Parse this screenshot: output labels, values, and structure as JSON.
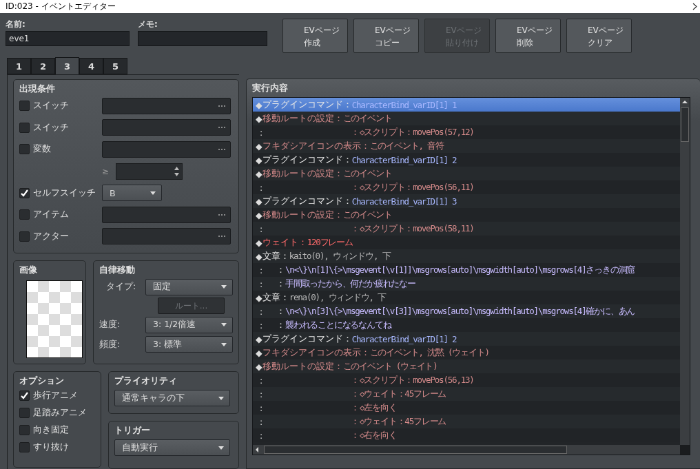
{
  "window": {
    "title": "ID:023 - イベントエディター"
  },
  "name_field": {
    "label": "名前:",
    "value": "eve1"
  },
  "memo_field": {
    "label": "メモ:"
  },
  "page_buttons": [
    {
      "lines": [
        "EVページ",
        "作成"
      ],
      "disabled": false
    },
    {
      "lines": [
        "EVページ",
        "コピー"
      ],
      "disabled": false
    },
    {
      "lines": [
        "EVページ",
        "貼り付け"
      ],
      "disabled": true
    },
    {
      "lines": [
        "EVページ",
        "削除"
      ],
      "disabled": false
    },
    {
      "lines": [
        "EVページ",
        "クリア"
      ],
      "disabled": false
    }
  ],
  "tabs": [
    {
      "label": "1",
      "selected": false
    },
    {
      "label": "2",
      "selected": false
    },
    {
      "label": "3",
      "selected": true
    },
    {
      "label": "4",
      "selected": false
    },
    {
      "label": "5",
      "selected": false
    }
  ],
  "conditions": {
    "title": "出現条件",
    "rows": [
      {
        "kind": "picker",
        "label": "スイッチ",
        "checked": false
      },
      {
        "kind": "picker",
        "label": "スイッチ",
        "checked": false
      },
      {
        "kind": "picker",
        "label": "変数",
        "checked": false
      },
      {
        "kind": "compare",
        "symbol": "≥"
      },
      {
        "kind": "dropdown",
        "label": "セルフスイッチ",
        "checked": true,
        "value": "B"
      },
      {
        "kind": "picker",
        "label": "アイテム",
        "checked": false
      },
      {
        "kind": "picker",
        "label": "アクター",
        "checked": false
      }
    ]
  },
  "image": {
    "title": "画像"
  },
  "movement": {
    "title": "自律移動",
    "type": {
      "label": "タイプ:",
      "value": "固定"
    },
    "route_button": {
      "label": "ルート...",
      "disabled": true
    },
    "speed": {
      "label": "速度:",
      "value": "3: 1/2倍速"
    },
    "frequency": {
      "label": "頻度:",
      "value": "3: 標準"
    }
  },
  "options": {
    "title": "オプション",
    "items": [
      {
        "label": "歩行アニメ",
        "checked": true
      },
      {
        "label": "足踏みアニメ",
        "checked": false
      },
      {
        "label": "向き固定",
        "checked": false
      },
      {
        "label": "すり抜け",
        "checked": false
      }
    ]
  },
  "priority": {
    "title": "プライオリティ",
    "value": "通常キャラの下"
  },
  "trigger": {
    "title": "トリガー",
    "value": "自動実行"
  },
  "commands": {
    "title": "実行内容",
    "rows": [
      {
        "kind": "plugin",
        "marker": "◆",
        "label": "プラグインコマンド：",
        "value": "CharacterBind_varID[1] 1",
        "selected": true
      },
      {
        "kind": "route",
        "marker": "◆",
        "label": "移動ルートの設定：",
        "value": "このイベント",
        "selected": false
      },
      {
        "kind": "route_step",
        "marker": ":",
        "label": "：",
        "value": "◇スクリプト：movePos(57,12)",
        "selected": false
      },
      {
        "kind": "balloon",
        "marker": "◆",
        "label": "フキダシアイコンの表示：",
        "value": "このイベント, 音符",
        "selected": false
      },
      {
        "kind": "plugin",
        "marker": "◆",
        "label": "プラグインコマンド：",
        "value": "CharacterBind_varID[1] 2",
        "selected": false
      },
      {
        "kind": "route",
        "marker": "◆",
        "label": "移動ルートの設定：",
        "value": "このイベント",
        "selected": false
      },
      {
        "kind": "route_step",
        "marker": ":",
        "label": "：",
        "value": "◇スクリプト：movePos(56,11)",
        "selected": false
      },
      {
        "kind": "plugin",
        "marker": "◆",
        "label": "プラグインコマンド：",
        "value": "CharacterBind_varID[1] 3",
        "selected": false
      },
      {
        "kind": "route",
        "marker": "◆",
        "label": "移動ルートの設定：",
        "value": "このイベント",
        "selected": false
      },
      {
        "kind": "route_step",
        "marker": ":",
        "label": "：",
        "value": "◇スクリプト：movePos(58,11)",
        "selected": false
      },
      {
        "kind": "wait",
        "marker": "◆",
        "label": "ウェイト：",
        "value": "120フレーム",
        "selected": false
      },
      {
        "kind": "text",
        "marker": "◆",
        "label": "文章：",
        "value": "kaito(0), ウィンドウ, 下",
        "selected": false
      },
      {
        "kind": "text_line",
        "marker": ":",
        "label": "：",
        "value": "\\n<\\}\\n[1]\\{>\\msgevent[\\v[1]]\\msgrows[auto]\\msgwidth[auto]\\msgrows[4]さっきの洞窟",
        "selected": false
      },
      {
        "kind": "text_line",
        "marker": ":",
        "label": "：",
        "value": "手間取ったから、何だか疲れたなー",
        "selected": false
      },
      {
        "kind": "text",
        "marker": "◆",
        "label": "文章：",
        "value": "rena(0), ウィンドウ, 下",
        "selected": false
      },
      {
        "kind": "text_line",
        "marker": ":",
        "label": "：",
        "value": "\\n<\\}\\n[3]\\{>\\msgevent[\\v[3]]\\msgrows[auto]\\msgwidth[auto]\\msgrows[4]確かに、あん",
        "selected": false
      },
      {
        "kind": "text_line",
        "marker": ":",
        "label": "：",
        "value": "襲われることになるなんてね",
        "selected": false
      },
      {
        "kind": "plugin",
        "marker": "◆",
        "label": "プラグインコマンド：",
        "value": "CharacterBind_varID[1] 2",
        "selected": false
      },
      {
        "kind": "balloon",
        "marker": "◆",
        "label": "フキダシアイコンの表示：",
        "value": "このイベント, 沈黙 (ウェイト)",
        "selected": false
      },
      {
        "kind": "route",
        "marker": "◆",
        "label": "移動ルートの設定：",
        "value": "このイベント (ウェイト)",
        "selected": false
      },
      {
        "kind": "route_step",
        "marker": ":",
        "label": "：",
        "value": "◇スクリプト：movePos(56,13)",
        "selected": false
      },
      {
        "kind": "route_step",
        "marker": ":",
        "label": "：",
        "value": "◇ウェイト：45フレーム",
        "selected": false
      },
      {
        "kind": "route_step",
        "marker": ":",
        "label": "：",
        "value": "◇左を向く",
        "selected": false
      },
      {
        "kind": "route_step",
        "marker": ":",
        "label": "：",
        "value": "◇ウェイト：45フレーム",
        "selected": false
      },
      {
        "kind": "route_step",
        "marker": ":",
        "label": "：",
        "value": "◇右を向く",
        "selected": false
      }
    ]
  }
}
